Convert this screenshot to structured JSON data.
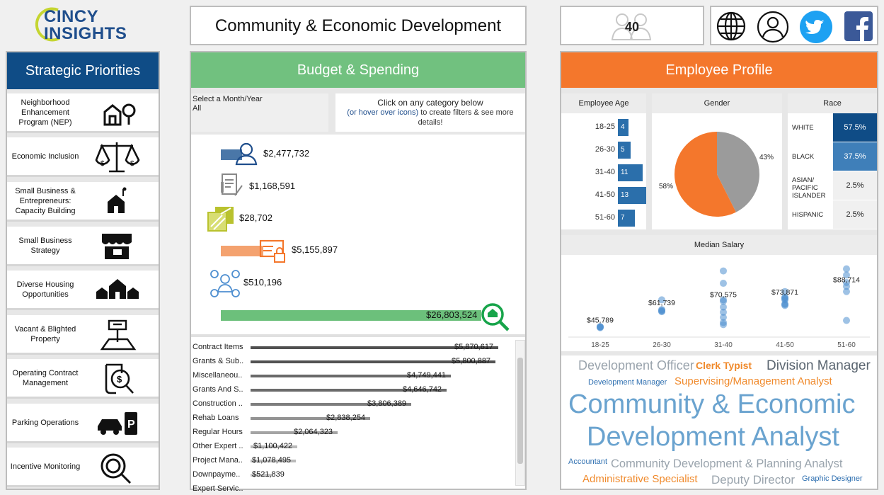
{
  "logo": {
    "line1": "CINCY",
    "line2": "INSIGHTS"
  },
  "header": {
    "title": "Community & Economic Development",
    "employee_count": "40"
  },
  "social": [
    "globe-icon",
    "user-icon",
    "twitter-icon",
    "facebook-icon"
  ],
  "sidebar": {
    "title": "Strategic Priorities",
    "items": [
      {
        "label": "Neighborhood Enhancement Program (NEP)",
        "icon": "houses-icon"
      },
      {
        "label": "Economic Inclusion",
        "icon": "scales-icon"
      },
      {
        "label": "Small Business & Entrepreneurs: Capacity Building",
        "icon": "house-flag-icon"
      },
      {
        "label": "Small Business Strategy",
        "icon": "storefront-icon"
      },
      {
        "label": "Diverse Housing Opportunities",
        "icon": "neighborhood-icon"
      },
      {
        "label": "Vacant & Blighted Property",
        "icon": "lot-sign-icon"
      },
      {
        "label": "Operating Contract Management",
        "icon": "contract-search-icon"
      },
      {
        "label": "Parking Operations",
        "icon": "parking-icon"
      },
      {
        "label": "Incentive Monitoring",
        "icon": "magnifier-icon"
      }
    ]
  },
  "budget": {
    "title": "Budget & Spending",
    "filter_label": "Select a Month/Year",
    "filter_value": "All",
    "hint_line1": "Click on any category below",
    "hint_link": "(or hover over icons)",
    "hint_rest": "to create filters & see more details!",
    "categories": [
      {
        "icon": "personnel-icon",
        "value": "$2,477,732",
        "amount": 2477732,
        "color": "#4a77a8"
      },
      {
        "icon": "documents-icon",
        "value": "$1,168,591",
        "amount": 1168591,
        "color": "#9a9a9a"
      },
      {
        "icon": "materials-icon",
        "value": "$28,702",
        "amount": 28702,
        "color": "#b9c22e"
      },
      {
        "icon": "fixed-charges-icon",
        "value": "$5,155,897",
        "amount": 5155897,
        "color": "#f4a26f"
      },
      {
        "icon": "services-icon",
        "value": "$510,196",
        "amount": 510196,
        "color": "#4f8fd0"
      },
      {
        "icon": "total-search-icon",
        "value": "$26,803,524",
        "amount": 26803524,
        "color": "#6cc07b"
      }
    ],
    "list": [
      {
        "label": "Contract Items",
        "value": "$5,870,617",
        "amount": 5870617
      },
      {
        "label": "Grants & Sub..",
        "value": "$5,800,887",
        "amount": 5800887
      },
      {
        "label": "Miscellaneou..",
        "value": "$4,749,441",
        "amount": 4749441
      },
      {
        "label": "Grants And S..",
        "value": "$4,646,742",
        "amount": 4646742
      },
      {
        "label": "Construction ..",
        "value": "$3,806,389",
        "amount": 3806389
      },
      {
        "label": "Rehab Loans",
        "value": "$2,838,254",
        "amount": 2838254
      },
      {
        "label": "Regular Hours",
        "value": "$2,064,323",
        "amount": 2064323
      },
      {
        "label": "Other Expert ..",
        "value": "$1,100,422",
        "amount": 1100422
      },
      {
        "label": "Project Mana..",
        "value": "$1,078,495",
        "amount": 1078495
      },
      {
        "label": "Downpayme..",
        "value": "$521,839",
        "amount": 521839
      },
      {
        "label": "Expert Servic..",
        "value": "",
        "amount": 0
      }
    ]
  },
  "employee": {
    "title": "Employee Profile",
    "age": {
      "title": "Employee Age",
      "groups": [
        {
          "label": "18-25",
          "count": 4
        },
        {
          "label": "26-30",
          "count": 5
        },
        {
          "label": "31-40",
          "count": 11
        },
        {
          "label": "41-50",
          "count": 13
        },
        {
          "label": "51-60",
          "count": 7
        }
      ]
    },
    "gender": {
      "title": "Gender",
      "slices": [
        {
          "label": "58%",
          "value": 58,
          "color": "#f4772c"
        },
        {
          "label": "43%",
          "value": 43,
          "color": "#9b9b9b"
        }
      ]
    },
    "race": {
      "title": "Race",
      "rows": [
        {
          "label": "WHITE",
          "value": "57.5%",
          "bg": "#0f4c86",
          "fg": "#ffffff"
        },
        {
          "label": "BLACK",
          "value": "37.5%",
          "bg": "#3f7fb9",
          "fg": "#ffffff"
        },
        {
          "label": "ASIAN/ PACIFIC ISLANDER",
          "value": "2.5%",
          "bg": "#f0f0f0",
          "fg": "#222222"
        },
        {
          "label": "HISPANIC",
          "value": "2.5%",
          "bg": "#f0f0f0",
          "fg": "#222222"
        }
      ]
    }
  },
  "chart_data": {
    "type": "scatter",
    "title": "Median Salary",
    "categories": [
      "18-25",
      "26-30",
      "31-40",
      "41-50",
      "51-60"
    ],
    "medians": [
      "$45,789",
      "$61,739",
      "$70,575",
      "$73,871",
      "$88,714"
    ],
    "series": [
      {
        "category": "18-25",
        "values": [
          45000,
          45500,
          46000,
          45789
        ]
      },
      {
        "category": "26-30",
        "values": [
          72000,
          60500,
          61739,
          62500,
          61000
        ]
      },
      {
        "category": "31-40",
        "values": [
          100000,
          88000,
          72000,
          70575,
          65000,
          60000,
          55000,
          50000,
          48000
        ]
      },
      {
        "category": "41-50",
        "values": [
          80000,
          74500,
          73871,
          73000,
          72000,
          68000,
          67500,
          66500
        ]
      },
      {
        "category": "51-60",
        "values": [
          102000,
          96000,
          88714,
          85000,
          80000,
          52000
        ]
      }
    ],
    "ylim": [
      40000,
      110000
    ]
  },
  "word_cloud": [
    {
      "text": "Development Officer",
      "color": "#9aa4ad"
    },
    {
      "text": "Clerk Typist",
      "color": "#f08a2c"
    },
    {
      "text": "Division Manager",
      "color": "#5a6570"
    },
    {
      "text": "Development Manager",
      "color": "#2e6fb0"
    },
    {
      "text": "Supervising/Management Analyst",
      "color": "#f08a2c"
    },
    {
      "text": "Community & Economic",
      "color": "#6aa3cf"
    },
    {
      "text": "Development Analyst",
      "color": "#6aa3cf"
    },
    {
      "text": "Accountant",
      "color": "#2e6fb0"
    },
    {
      "text": "Community Development & Planning Analyst",
      "color": "#9aa4ad"
    },
    {
      "text": "Administrative Specialist",
      "color": "#f08a2c"
    },
    {
      "text": "Deputy Director",
      "color": "#9aa4ad"
    },
    {
      "text": "Graphic Designer",
      "color": "#2e6fb0"
    }
  ]
}
